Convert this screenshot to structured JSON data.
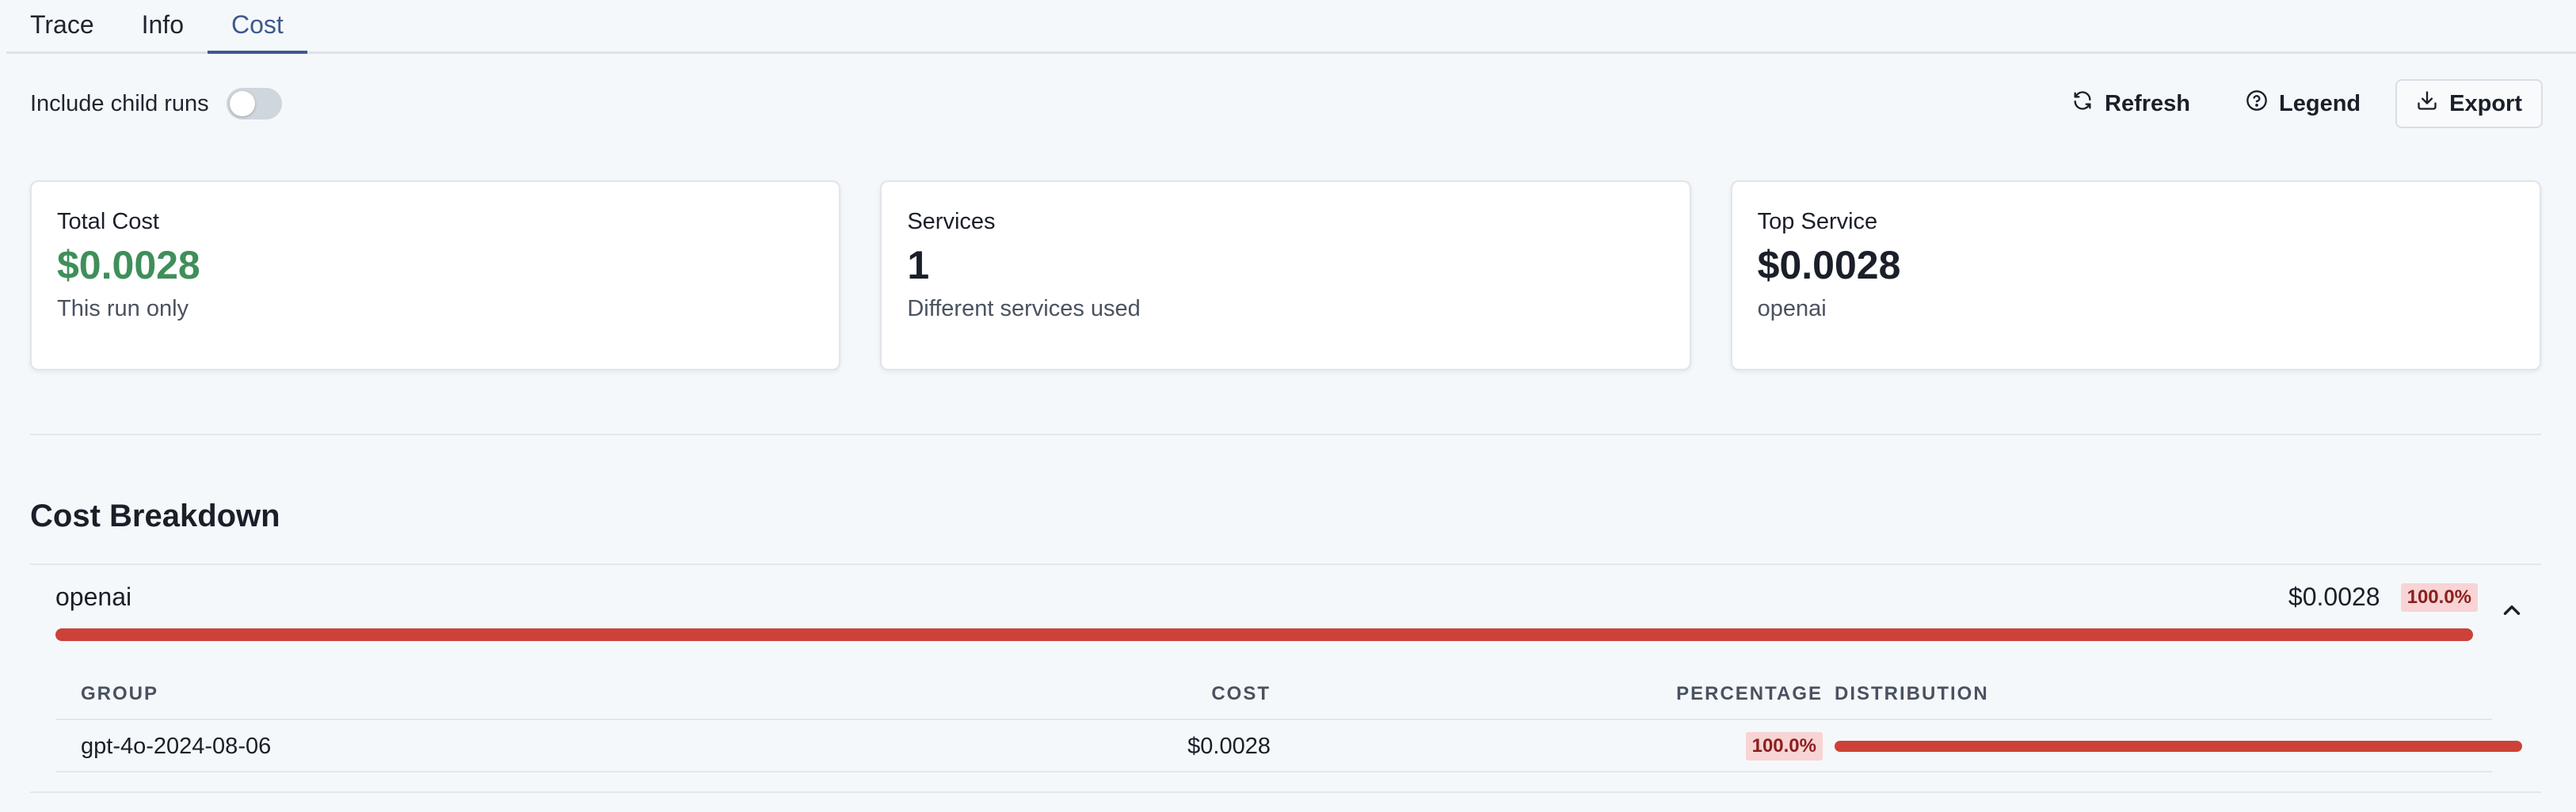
{
  "tabs": [
    {
      "label": "Trace",
      "active": false
    },
    {
      "label": "Info",
      "active": false
    },
    {
      "label": "Cost",
      "active": true
    }
  ],
  "toolbar": {
    "include_child_runs_label": "Include child runs",
    "include_child_runs_on": false,
    "refresh_label": "Refresh",
    "legend_label": "Legend",
    "export_label": "Export"
  },
  "cards": {
    "total_cost": {
      "title": "Total Cost",
      "value": "$0.0028",
      "sub": "This run only"
    },
    "services": {
      "title": "Services",
      "value": "1",
      "sub": "Different services used"
    },
    "top_service": {
      "title": "Top Service",
      "value": "$0.0028",
      "sub": "openai"
    }
  },
  "breakdown": {
    "title": "Cost Breakdown",
    "services": [
      {
        "name": "openai",
        "cost": "$0.0028",
        "percentage": "100.0%",
        "fraction": 1.0,
        "expanded": true,
        "table": {
          "headers": {
            "group": "GROUP",
            "cost": "COST",
            "percentage": "PERCENTAGE",
            "distribution": "DISTRIBUTION"
          },
          "rows": [
            {
              "group": "gpt-4o-2024-08-06",
              "cost": "$0.0028",
              "percentage": "100.0%",
              "fraction": 1.0
            }
          ]
        }
      }
    ]
  },
  "colors": {
    "accent": "#3d5a8e",
    "cost_green": "#3f8f5a",
    "bar_red": "#cc4238",
    "badge_bg": "#f8d4d4"
  },
  "icons": {
    "refresh": "refresh-icon",
    "legend": "help-circle-icon",
    "export": "download-icon",
    "collapse": "chevron-up-icon"
  }
}
